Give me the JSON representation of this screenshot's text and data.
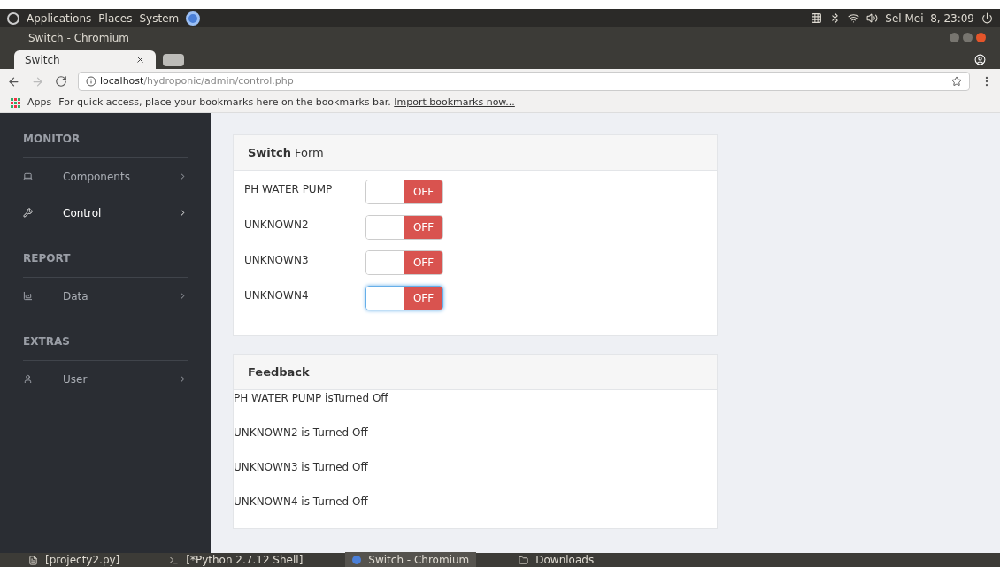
{
  "top_panel": {
    "menus": [
      "Applications",
      "Places",
      "System"
    ],
    "clock": "Sel Mei  8, 23:09"
  },
  "window": {
    "title": "Switch - Chromium"
  },
  "tabs": [
    {
      "label": "Switch",
      "selected": true
    }
  ],
  "address_bar": {
    "host": "localhost",
    "path": "/hydroponic/admin/control.php"
  },
  "bookmarks_bar": {
    "apps": "Apps",
    "message": "For quick access, place your bookmarks here on the bookmarks bar.",
    "link": "Import bookmarks now..."
  },
  "sidebar": {
    "sections": [
      {
        "heading": "MONITOR",
        "items": [
          {
            "label": "Components",
            "selected": false
          },
          {
            "label": "Control",
            "selected": true
          }
        ]
      },
      {
        "heading": "REPORT",
        "items": [
          {
            "label": "Data",
            "selected": false
          }
        ]
      },
      {
        "heading": "EXTRAS",
        "items": [
          {
            "label": "User",
            "selected": false
          }
        ]
      }
    ]
  },
  "switch_form": {
    "title_bold": "Switch",
    "title_rest": "Form",
    "switches": [
      {
        "label": "PH WATER PUMP",
        "on": false,
        "state_text": "OFF",
        "focused": false
      },
      {
        "label": "UNKNOWN2",
        "on": false,
        "state_text": "OFF",
        "focused": false
      },
      {
        "label": "UNKNOWN3",
        "on": false,
        "state_text": "OFF",
        "focused": false
      },
      {
        "label": "UNKNOWN4",
        "on": false,
        "state_text": "OFF",
        "focused": true
      }
    ]
  },
  "feedback": {
    "title": "Feedback",
    "lines": [
      "PH WATER PUMP isTurned Off",
      "UNKNOWN2 is Turned Off",
      "UNKNOWN3 is Turned Off",
      "UNKNOWN4 is Turned Off"
    ]
  },
  "taskbar": {
    "items": [
      {
        "label": "[projecty2.py]",
        "selected": false
      },
      {
        "label": "[*Python 2.7.12 Shell]",
        "selected": false
      },
      {
        "label": "Switch - Chromium",
        "selected": true
      },
      {
        "label": "Downloads",
        "selected": false
      }
    ]
  }
}
